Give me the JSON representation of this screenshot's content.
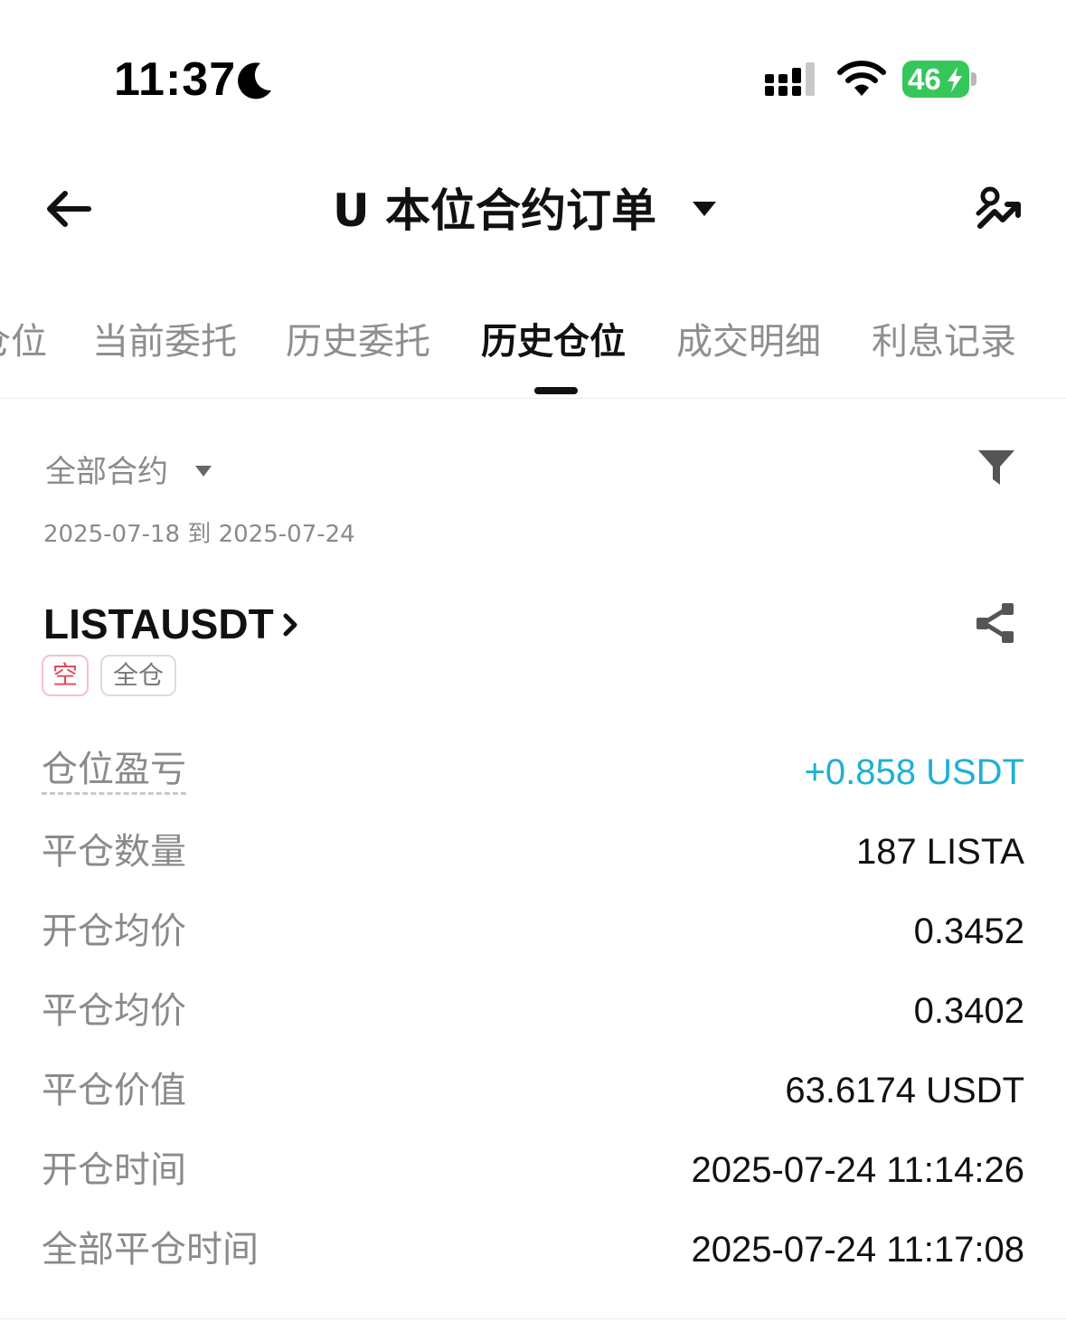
{
  "status_bar": {
    "time": "11:37",
    "battery_level": "46",
    "battery_color": "#35c759"
  },
  "header": {
    "title": "U 本位合约订单",
    "icons": [
      "back-arrow-icon",
      "caret-down-icon",
      "analysis-chart-icon"
    ]
  },
  "tabs": [
    {
      "label": "仓位"
    },
    {
      "label": "当前委托"
    },
    {
      "label": "历史委托"
    },
    {
      "label": "历史仓位",
      "active": true
    },
    {
      "label": "成交明细"
    },
    {
      "label": "利息记录"
    }
  ],
  "filter": {
    "contract_label": "全部合约",
    "date_range": "2025-07-18 到 2025-07-24"
  },
  "position": {
    "symbol": "LISTAUSDT",
    "tags": {
      "side": "空",
      "margin_mode": "全仓"
    },
    "rows": [
      {
        "label": "仓位盈亏",
        "value": "+0.858 USDT"
      },
      {
        "label": "平仓数量",
        "value": "187 LISTA"
      },
      {
        "label": "开仓均价",
        "value": "0.3452"
      },
      {
        "label": "平仓均价",
        "value": "0.3402"
      },
      {
        "label": "平仓价值",
        "value": "63.6174 USDT"
      },
      {
        "label": "开仓时间",
        "value": "2025-07-24 11:14:26"
      },
      {
        "label": "全部平仓时间",
        "value": "2025-07-24 11:17:08"
      }
    ],
    "colors": {
      "pnl_positive": "#1fb0d4",
      "short_tag": "#e24a58"
    }
  }
}
